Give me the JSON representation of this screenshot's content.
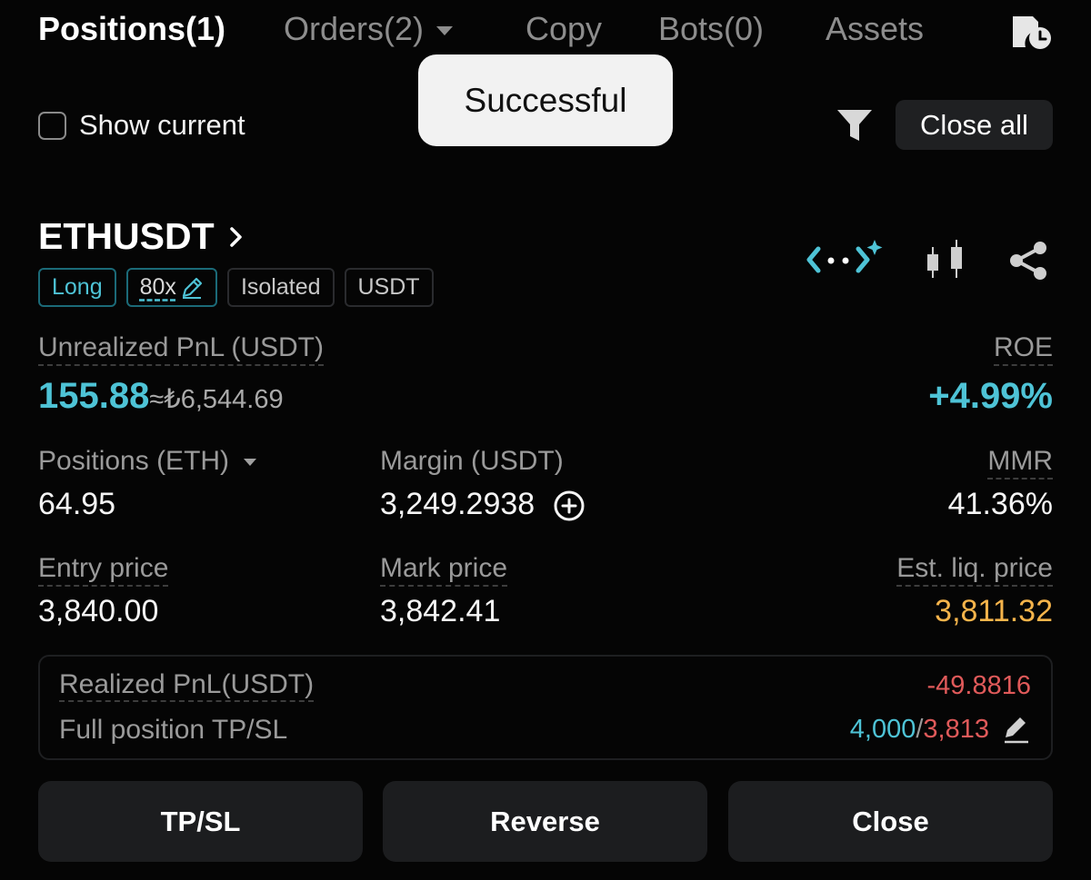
{
  "tabs": [
    {
      "label": "Positions(1)",
      "active": true
    },
    {
      "label": "Orders(2)",
      "has_dropdown": true
    },
    {
      "label": "Copy"
    },
    {
      "label": "Bots(0)"
    },
    {
      "label": "Assets"
    }
  ],
  "toast": {
    "message": "Successful"
  },
  "filters": {
    "show_current_label": "Show current",
    "show_current_checked": false,
    "close_all_label": "Close all"
  },
  "position": {
    "symbol": "ETHUSDT",
    "badges": {
      "side": "Long",
      "leverage": "80x",
      "margin_mode": "Isolated",
      "settle": "USDT"
    },
    "unrealized_pnl": {
      "label": "Unrealized PnL (USDT)",
      "value": "155.88",
      "converted": "≈₺6,544.69"
    },
    "roe": {
      "label": "ROE",
      "value": "+4.99%"
    },
    "size": {
      "label": "Positions (ETH)",
      "value": "64.95"
    },
    "margin": {
      "label": "Margin (USDT)",
      "value": "3,249.2938"
    },
    "mmr": {
      "label": "MMR",
      "value": "41.36%"
    },
    "entry_price": {
      "label": "Entry price",
      "value": "3,840.00"
    },
    "mark_price": {
      "label": "Mark price",
      "value": "3,842.41"
    },
    "liq_price": {
      "label": "Est. liq. price",
      "value": "3,811.32"
    },
    "realized_pnl": {
      "label": "Realized PnL(USDT)",
      "value": "-49.8816"
    },
    "tpsl": {
      "label": "Full position TP/SL",
      "tp": "4,000",
      "separator": "/",
      "sl": "3,813"
    }
  },
  "actions": {
    "tpsl": "TP/SL",
    "reverse": "Reverse",
    "close": "Close"
  },
  "colors": {
    "accent": "#4ec3d6",
    "liq": "#f6b44b",
    "negative": "#e05a5a",
    "background": "#050505"
  },
  "icons": [
    "history-icon",
    "filter-icon",
    "chevron-right-icon",
    "edit-icon",
    "ai-assistant-icon",
    "candlestick-chart-icon",
    "share-icon",
    "plus-circle-icon"
  ]
}
